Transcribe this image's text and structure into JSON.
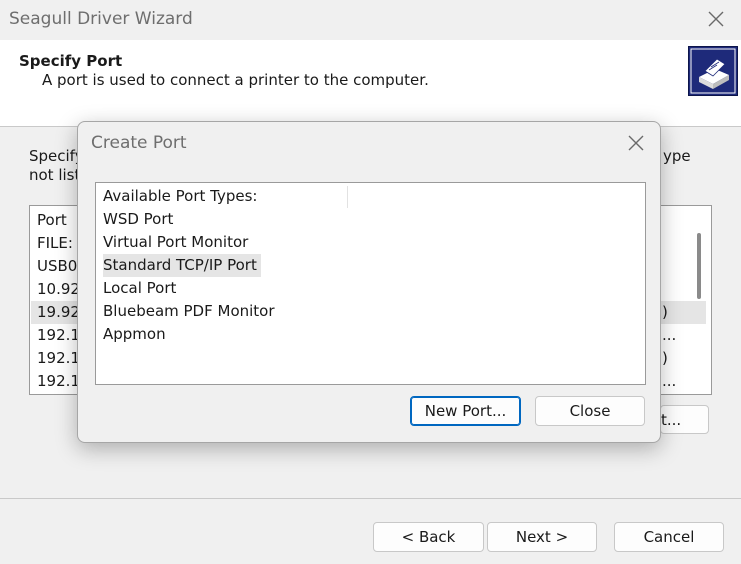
{
  "wizard": {
    "title": "Seagull Driver Wizard",
    "header_title": "Specify Port",
    "header_subtitle": "A port is used to connect a printer to the computer.",
    "instr_line1_start": "Specify",
    "instr_line1_end": "ype",
    "instr_line2_start": "not list",
    "port_list": {
      "header": "Port",
      "rows": [
        {
          "left": "FILE:",
          "right": ""
        },
        {
          "left": "USB0(",
          "right": ""
        },
        {
          "left": "10.92",
          "right": ""
        },
        {
          "left": "19.92",
          "right": ")"
        },
        {
          "left": "192.1",
          "right": "..."
        },
        {
          "left": "192.1",
          "right": ")"
        },
        {
          "left": "192.1",
          "right": "..."
        }
      ],
      "selected_index": 3
    },
    "partial_button_label": "t...",
    "back_label": "< Back",
    "next_label": "Next >",
    "cancel_label": "Cancel"
  },
  "dialog": {
    "title": "Create Port",
    "list_header": "Available Port Types:",
    "port_types": [
      "WSD Port",
      "Virtual Port Monitor",
      "Standard TCP/IP Port",
      "Local Port",
      "Bluebeam PDF Monitor",
      "Appmon"
    ],
    "selected_index": 2,
    "new_port_label": "New Port...",
    "close_label": "Close"
  },
  "colors": {
    "accent": "#0067c0",
    "selection": "#e5e5e5",
    "logo_bg": "#1e2a7a"
  }
}
